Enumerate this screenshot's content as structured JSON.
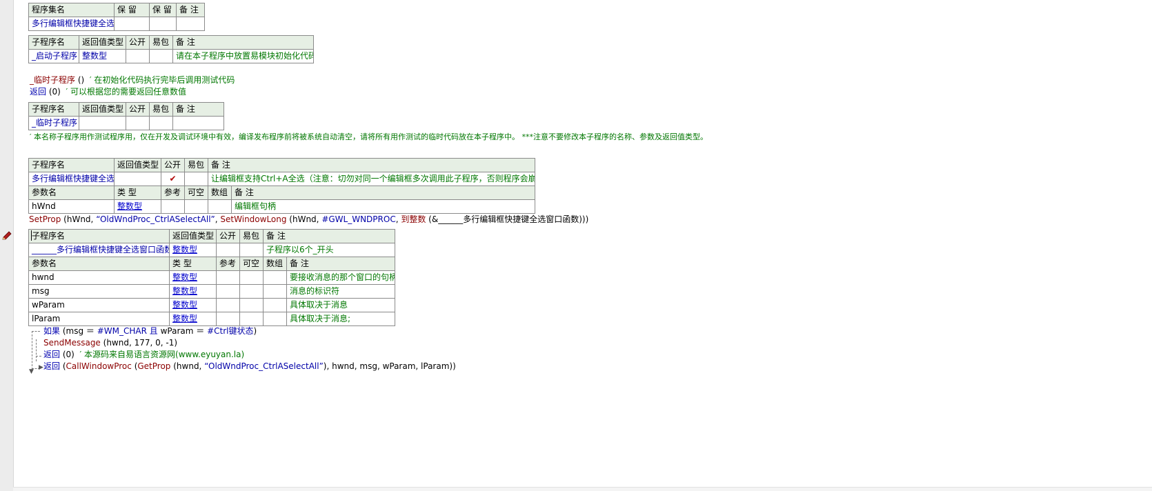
{
  "assembly_table": {
    "headers": [
      "程序集名",
      "保 留",
      "保 留",
      "备 注"
    ],
    "row": [
      "多行编辑框快捷键全选",
      "",
      "",
      ""
    ]
  },
  "startup_table": {
    "headers": [
      "子程序名",
      "返回值类型",
      "公开",
      "易包",
      "备 注"
    ],
    "row": [
      "_启动子程序",
      "整数型",
      "",
      "",
      "请在本子程序中放置易模块初始化代码"
    ]
  },
  "startup_body": {
    "line1_name": "_临时子程序",
    "line1_parens": " ()",
    "line1_comment": "′ 在初始化代码执行完毕后调用测试代码",
    "line2_kw": "返回",
    "line2_args": " (0)",
    "line2_comment": "′ 可以根据您的需要返回任意数值"
  },
  "temp_table": {
    "headers": [
      "子程序名",
      "返回值类型",
      "公开",
      "易包",
      "备 注"
    ],
    "row": [
      "_临时子程序",
      "",
      "",
      "",
      ""
    ]
  },
  "temp_comment": "′ 本名称子程序用作测试程序用，仅在开发及调试环境中有效，编译发布程序前将被系统自动清空，请将所有用作测试的临时代码放在本子程序中。 ***注意不要修改本子程序的名称、参数及返回值类型。",
  "main_sub_table": {
    "headers": [
      "子程序名",
      "返回值类型",
      "公开",
      "易包",
      "备 注"
    ],
    "row": [
      "多行编辑框快捷键全选",
      "",
      "✔",
      "",
      "让编辑框支持Ctrl+A全选（注意：切勿对同一个编辑框多次调用此子程序，否则程序会崩溃）"
    ],
    "param_headers": [
      "参数名",
      "类 型",
      "参考",
      "可空",
      "数组",
      "备 注"
    ],
    "params": [
      [
        "hWnd",
        "整数型",
        "",
        "",
        "",
        "编辑框句柄"
      ]
    ]
  },
  "setprop_line": {
    "fn": "SetProp",
    "a1": " (hWnd, ",
    "str": "“OldWndProc_CtrlASelectAll”",
    "a2": ", ",
    "fn2": "SetWindowLong",
    "a3": " (hWnd, ",
    "const": "#GWL_WNDPROC",
    "a4": ", ",
    "fn3": "到整数",
    "a5": " (&",
    "ref": "______多行编辑框快捷键全选窗口函数",
    "a6": ")))"
  },
  "wndproc_table": {
    "headers": [
      "子程序名",
      "返回值类型",
      "公开",
      "易包",
      "备 注"
    ],
    "row": [
      "______多行编辑框快捷键全选窗口函数",
      "整数型",
      "",
      "",
      "子程序以6个_开头"
    ],
    "param_headers": [
      "参数名",
      "类 型",
      "参考",
      "可空",
      "数组",
      "备 注"
    ],
    "params": [
      [
        "hwnd",
        "整数型",
        "",
        "",
        "",
        "要接收消息的那个窗口的句柄"
      ],
      [
        "msg",
        "整数型",
        "",
        "",
        "",
        "消息的标识符"
      ],
      [
        "wParam",
        "整数型",
        "",
        "",
        "",
        "具体取决于消息"
      ],
      [
        "lParam",
        "整数型",
        "",
        "",
        "",
        "具体取决于消息;"
      ]
    ]
  },
  "wndproc_body": {
    "if_kw": "如果",
    "if_args": " (msg ＝ ",
    "if_const1": "#WM_CHAR",
    "if_and": " 且 ",
    "if_args2": "wParam ＝ ",
    "if_const2": "#Ctrl键状态",
    "if_end": ")",
    "send_fn": "SendMessage",
    "send_args": " (hwnd, 177, 0, -1)",
    "ret1_kw": "返回",
    "ret1_args": " (0)",
    "ret1_comment": "′ 本源码来自易语言资源网(www.eyuyan.la)",
    "ret2_kw": "返回",
    "ret2_a1": " (",
    "ret2_fn": "CallWindowProc",
    "ret2_a2": " (",
    "ret2_fn2": "GetProp",
    "ret2_a3": " (hwnd, ",
    "ret2_str": "“OldWndProc_CtrlASelectAll”",
    "ret2_a4": "), hwnd, msg, wParam, lParam))"
  },
  "colors": {
    "header_bg": "#e6efe4",
    "keyword": "#0000a8",
    "function": "#8b0000",
    "comment": "#007700"
  },
  "icons": [
    "pencil-icon",
    "check-icon",
    "flow-arrow-icon"
  ]
}
